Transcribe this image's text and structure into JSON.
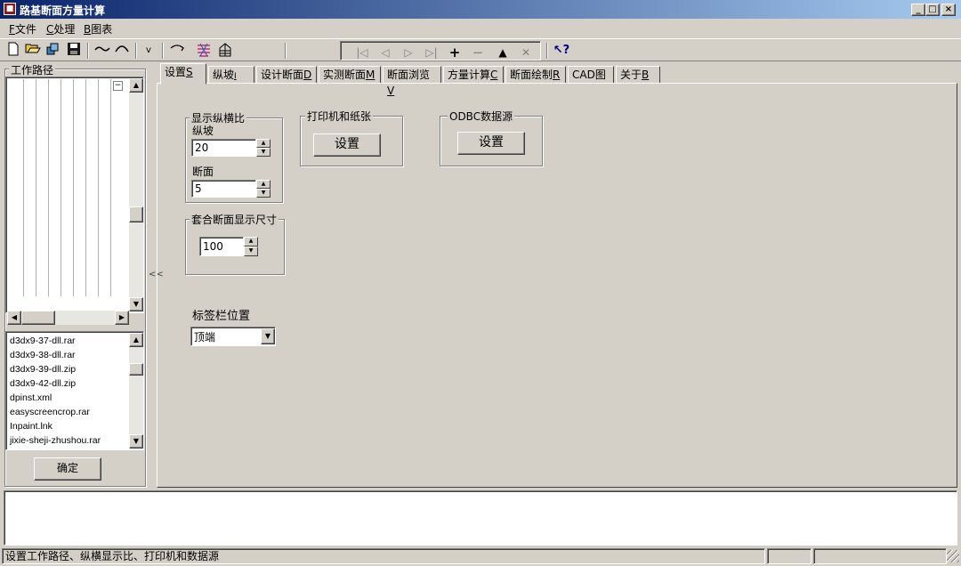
{
  "window": {
    "title": "路基断面方量计算",
    "min": "_",
    "max": "□",
    "close": "×"
  },
  "menu": [
    {
      "hot": "F",
      "label": "文件"
    },
    {
      "hot": "C",
      "label": "处理"
    },
    {
      "hot": "B",
      "label": "图表"
    }
  ],
  "toolbar": {
    "icons": [
      "new-file-icon",
      "open-folder-icon",
      "copy-icon",
      "save-icon",
      "curve-icon",
      "arc-icon",
      "check-icon",
      "bend-icon",
      "layers-icon",
      "building-icon"
    ],
    "nav_icons": [
      "first-record-icon",
      "prev-record-icon",
      "next-record-icon",
      "last-record-icon",
      "add-record-icon",
      "delete-record-icon",
      "edit-record-icon",
      "cancel-record-icon"
    ],
    "help_icon": "context-help-icon"
  },
  "left": {
    "work_path_label": "工作路径",
    "collapse": "⊟",
    "splitter": "<<",
    "files": [
      "d3dx9-37-dll.rar",
      "d3dx9-38-dll.rar",
      "d3dx9-39-dll.zip",
      "d3dx9-42-dll.zip",
      "dpinst.xml",
      "easyscreencrop.rar",
      "Inpaint.lnk",
      "jixie-sheji-zhushou.rar"
    ],
    "ok_button": "确定"
  },
  "tabs": [
    {
      "label": "设置",
      "hot": "S",
      "active": true
    },
    {
      "label": "纵坡",
      "hot": "I",
      "active": false
    },
    {
      "label": "设计断面",
      "hot": "D",
      "active": false
    },
    {
      "label": "实测断面",
      "hot": "M",
      "active": false
    },
    {
      "label": "断面浏览",
      "hot": "V",
      "active": false
    },
    {
      "label": "方量计算",
      "hot": "C",
      "active": false
    },
    {
      "label": "断面绘制",
      "hot": "R",
      "active": false
    },
    {
      "label": "CAD图",
      "hot": "",
      "active": false
    },
    {
      "label": "关于",
      "hot": "B",
      "active": false
    }
  ],
  "settings": {
    "ratio_group": "显示纵横比",
    "slope_label": "纵坡",
    "slope_value": "20",
    "section_label": "断面",
    "section_value": "5",
    "printer_group": "打印机和纸张",
    "printer_button": "设置",
    "odbc_group": "ODBC数据源",
    "odbc_button": "设置",
    "overlay_group": "套合断面显示尺寸",
    "overlay_value": "100",
    "tabpos_label": "标签栏位置",
    "tabpos_value": "顶端"
  },
  "status": {
    "text": "设置工作路径、纵横显示比、打印机和数据源"
  }
}
